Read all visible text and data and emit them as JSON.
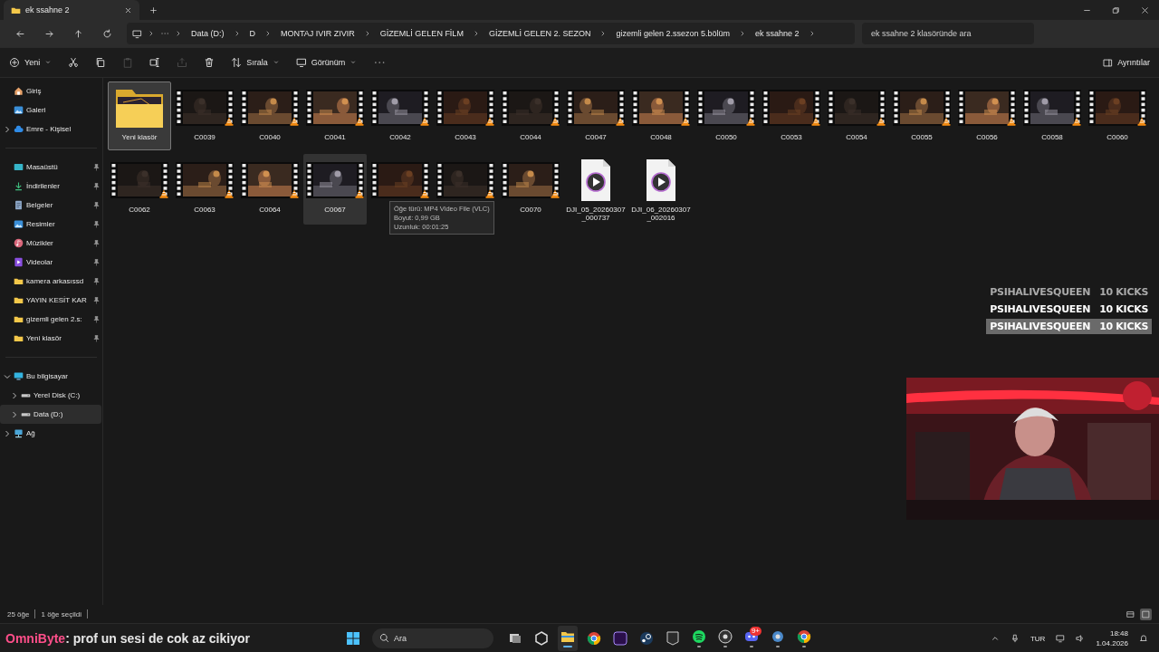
{
  "tab": {
    "title": "ek ssahne 2",
    "selected": true
  },
  "breadcrumb": [
    "Data (D:)",
    "D",
    "MONTAJ IVIR ZIVIR",
    "GİZEMLİ GELEN FİLM",
    "GİZEMLİ GELEN 2. SEZON",
    "gizemli gelen 2.ssezon 5.bölüm",
    "ek ssahne 2"
  ],
  "search": {
    "placeholder": "ek ssahne 2 klasöründe ara"
  },
  "toolbar": {
    "new": "Yeni",
    "sort": "Sırala",
    "view": "Görünüm",
    "details": "Ayrıntılar"
  },
  "sidebar": {
    "groups": [
      [
        {
          "label": "Giriş",
          "kind": "home",
          "selected": false
        },
        {
          "label": "Galeri",
          "kind": "gallery",
          "selected": false
        },
        {
          "label": "Emre - Kişisel",
          "kind": "cloud",
          "expanded": false,
          "selected": false
        }
      ],
      [
        {
          "label": "Masaüstü",
          "kind": "desktop",
          "pinned": true,
          "selected": false
        },
        {
          "label": "İndirilenler",
          "kind": "downloads",
          "pinned": true,
          "selected": false
        },
        {
          "label": "Belgeler",
          "kind": "documents",
          "pinned": true,
          "selected": false
        },
        {
          "label": "Resimler",
          "kind": "pictures",
          "pinned": true,
          "selected": false
        },
        {
          "label": "Müzikler",
          "kind": "music",
          "pinned": true,
          "selected": false
        },
        {
          "label": "Videolar",
          "kind": "videos",
          "pinned": true,
          "selected": false
        },
        {
          "label": "kamera arkasıssd",
          "kind": "folder",
          "pinned": true,
          "selected": false
        },
        {
          "label": "YAYIN KESİT KAR",
          "kind": "folder",
          "pinned": true,
          "selected": false
        },
        {
          "label": "gizemli gelen 2.s:",
          "kind": "folder",
          "pinned": true,
          "selected": false
        },
        {
          "label": "Yeni klasör",
          "kind": "folder",
          "pinned": true,
          "selected": false
        }
      ],
      [
        {
          "label": "Bu bilgisayar",
          "kind": "pc",
          "expanded": true,
          "selected": false,
          "children": [
            {
              "label": "Yerel Disk (C:)",
              "kind": "drive",
              "expanded": false,
              "selected": false
            },
            {
              "label": "Data (D:)",
              "kind": "drive",
              "expanded": false,
              "selected": true
            }
          ]
        },
        {
          "label": "Ağ",
          "kind": "network",
          "expanded": false,
          "selected": false
        }
      ]
    ]
  },
  "files": [
    {
      "name": "Yeni klasör",
      "kind": "folder",
      "selected": true,
      "hovered": false
    },
    {
      "name": "C0039",
      "kind": "video",
      "selected": false,
      "hovered": false
    },
    {
      "name": "C0040",
      "kind": "video",
      "selected": false,
      "hovered": false
    },
    {
      "name": "C0041",
      "kind": "video",
      "selected": false,
      "hovered": false
    },
    {
      "name": "C0042",
      "kind": "video",
      "selected": false,
      "hovered": false
    },
    {
      "name": "C0043",
      "kind": "video",
      "selected": false,
      "hovered": false
    },
    {
      "name": "C0044",
      "kind": "video",
      "selected": false,
      "hovered": false
    },
    {
      "name": "C0047",
      "kind": "video",
      "selected": false,
      "hovered": false
    },
    {
      "name": "C0048",
      "kind": "video",
      "selected": false,
      "hovered": false
    },
    {
      "name": "C0050",
      "kind": "video",
      "selected": false,
      "hovered": false
    },
    {
      "name": "C0053",
      "kind": "video",
      "selected": false,
      "hovered": false
    },
    {
      "name": "C0054",
      "kind": "video",
      "selected": false,
      "hovered": false
    },
    {
      "name": "C0055",
      "kind": "video",
      "selected": false,
      "hovered": false
    },
    {
      "name": "C0056",
      "kind": "video",
      "selected": false,
      "hovered": false
    },
    {
      "name": "C0058",
      "kind": "video",
      "selected": false,
      "hovered": false
    },
    {
      "name": "C0060",
      "kind": "video",
      "selected": false,
      "hovered": false
    },
    {
      "name": "C0062",
      "kind": "video",
      "selected": false,
      "hovered": false
    },
    {
      "name": "C0063",
      "kind": "video",
      "selected": false,
      "hovered": false
    },
    {
      "name": "C0064",
      "kind": "video",
      "selected": false,
      "hovered": false
    },
    {
      "name": "C0067",
      "kind": "video",
      "selected": false,
      "hovered": true
    },
    {
      "kind": "video",
      "selected": false,
      "hovered": false
    },
    {
      "kind": "video",
      "selected": false,
      "hovered": false
    },
    {
      "name": "C0070",
      "kind": "video",
      "selected": false,
      "hovered": false
    },
    {
      "name": "DJI_05_20260307_000737",
      "kind": "file",
      "selected": false,
      "hovered": false
    },
    {
      "name": "DJI_06_20260307_002016",
      "kind": "file",
      "selected": false,
      "hovered": false
    }
  ],
  "tooltip": {
    "lines": [
      "Öğe türü: MP4 Video File (VLC)",
      "Boyut: 0,99 GB",
      "Uzunluk: 00:01:25"
    ]
  },
  "status_bar": {
    "count": "25 öğe",
    "selection": "1 öğe seçildi",
    "view_modes": [
      {
        "kind": "details",
        "selected": false
      },
      {
        "kind": "icons",
        "selected": true
      }
    ]
  },
  "alerts": [
    {
      "name": "PSIHALIVESQUEEN",
      "amount": "10 KICKS",
      "kind": "old"
    },
    {
      "name": "PSIHALIVESQUEEN",
      "amount": "10 KICKS",
      "kind": "current"
    },
    {
      "name": "PSIHALIVESQUEEN",
      "amount": "10 KICKS",
      "kind": "latest"
    }
  ],
  "chat": {
    "user": "OmniByte",
    "message": ": prof un sesi de cok az cikiyor"
  },
  "taskbar": {
    "search": {
      "placeholder": "Ara"
    },
    "apps": [
      {
        "kind": "taskview",
        "active": false,
        "running": false
      },
      {
        "kind": "cube",
        "active": false,
        "running": false
      },
      {
        "kind": "explorer",
        "active": true,
        "running": true
      },
      {
        "kind": "chrome",
        "active": false,
        "running": false
      },
      {
        "kind": "premiere",
        "active": false,
        "running": false
      },
      {
        "kind": "steam",
        "active": false,
        "running": false
      },
      {
        "kind": "epic",
        "active": false,
        "running": false
      },
      {
        "kind": "spotify",
        "active": false,
        "running": true
      },
      {
        "kind": "obs",
        "active": false,
        "running": true
      },
      {
        "kind": "discord",
        "active": false,
        "running": true,
        "badge": "9+"
      },
      {
        "kind": "tool",
        "active": false,
        "running": true
      },
      {
        "kind": "chrome",
        "active": false,
        "running": true
      }
    ],
    "language": "TUR",
    "time": "18:48",
    "date": "1.04.2026"
  }
}
